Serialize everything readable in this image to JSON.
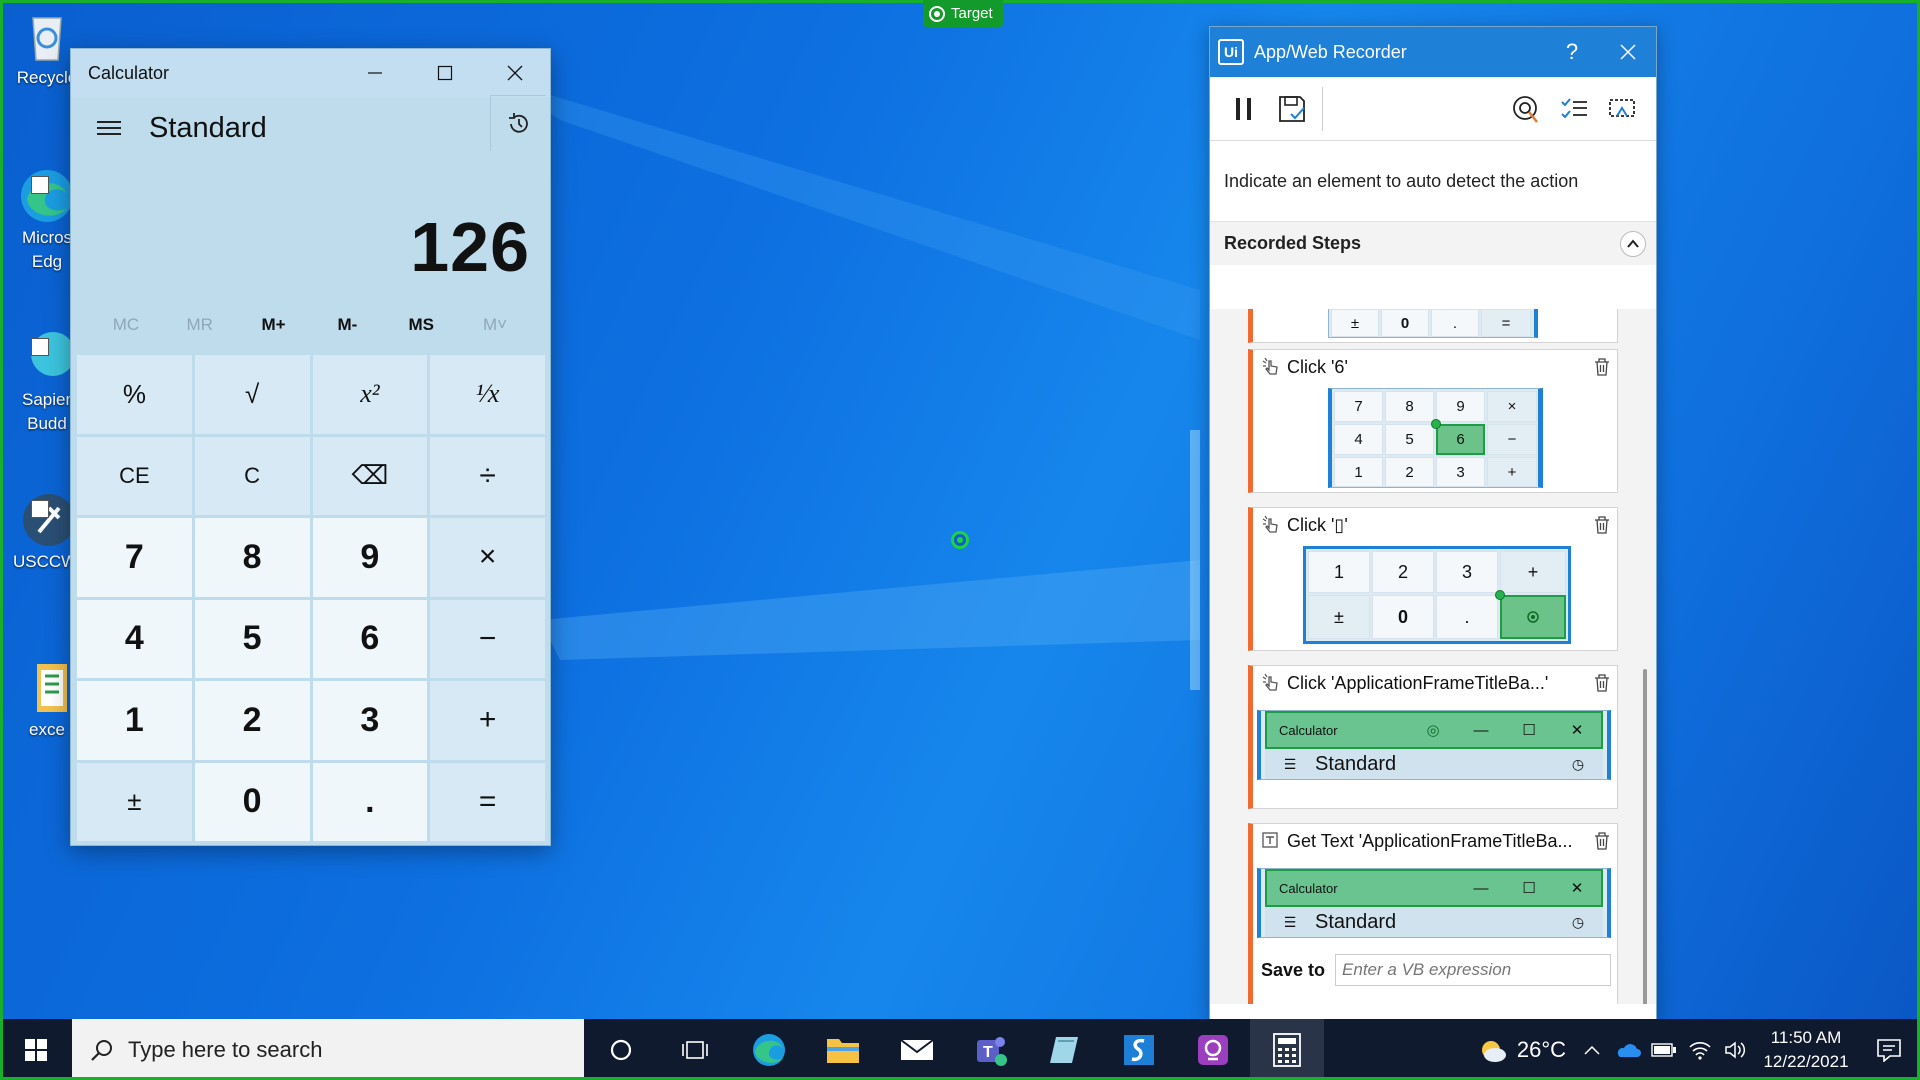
{
  "desktop": {
    "icons": [
      {
        "label": "Recycle",
        "icon": "recycle-bin-icon"
      },
      {
        "label": "Micros Edg",
        "icon": "edge-icon"
      },
      {
        "label": "Sapien Budd",
        "icon": "sapien-icon"
      },
      {
        "label": "USCCWi",
        "icon": "tools-icon"
      },
      {
        "label": "exce",
        "icon": "excel-file-icon"
      }
    ],
    "target_badge": "Target"
  },
  "calculator": {
    "title": "Calculator",
    "mode": "Standard",
    "display": "126",
    "memory": [
      "MC",
      "MR",
      "M+",
      "M-",
      "MS",
      "M˅"
    ],
    "keys": [
      "%",
      "√",
      "x²",
      "¹⁄x",
      "CE",
      "C",
      "⌫",
      "÷",
      "7",
      "8",
      "9",
      "×",
      "4",
      "5",
      "6",
      "−",
      "1",
      "2",
      "3",
      "+",
      "±",
      "0",
      ".",
      "="
    ]
  },
  "recorder": {
    "title": "App/Web Recorder",
    "help": "?",
    "hint": "Indicate an element to auto detect the action",
    "steps_title": "Recorded Steps",
    "steps": [
      {
        "label": "Click '6'"
      },
      {
        "label": "Click '▯'"
      },
      {
        "label": "Click 'ApplicationFrameTitleBa...'"
      },
      {
        "label": "Get Text 'ApplicationFrameTitleBa..."
      }
    ],
    "thumb_top_keys": [
      "±",
      "0",
      ".",
      "="
    ],
    "thumb_click6_keys": [
      "7",
      "8",
      "9",
      "×",
      "4",
      "5",
      "6",
      "−",
      "1",
      "2",
      "3",
      "+"
    ],
    "thumb_click_eq_keys": [
      "1",
      "2",
      "3",
      "+",
      "±",
      "0",
      ".",
      "="
    ],
    "thumb_calc_title": "Calculator",
    "thumb_calc_mode": "Standard",
    "save_to_label": "Save to",
    "save_to_placeholder": "Enter a VB expression"
  },
  "taskbar": {
    "search_placeholder": "Type here to search",
    "weather": "26°C",
    "time": "11:50 AM",
    "date": "12/22/2021"
  },
  "colors": {
    "accent": "#1e80d6",
    "highlight": "#1d9e45",
    "step_accent": "#f06b32"
  }
}
